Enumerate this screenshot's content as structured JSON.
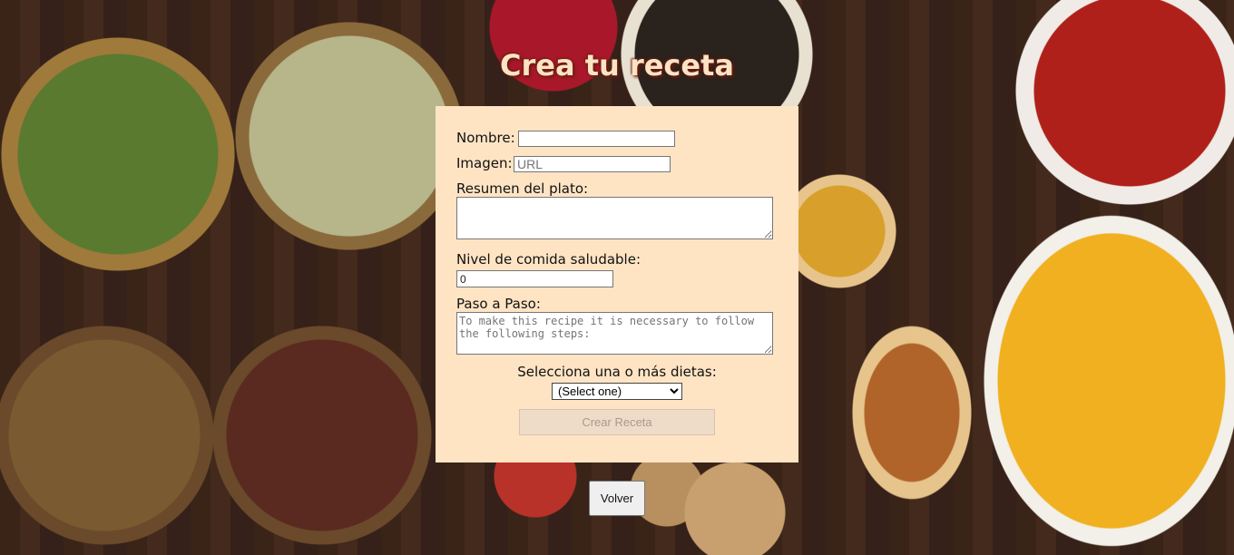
{
  "page": {
    "title": "Crea tu receta"
  },
  "form": {
    "nombre_label": "Nombre:",
    "nombre_value": "",
    "imagen_label": "Imagen:",
    "imagen_placeholder": "URL",
    "resumen_label": "Resumen del plato:",
    "resumen_value": "",
    "nivel_label": "Nivel de comida saludable:",
    "nivel_value": "0",
    "paso_label": "Paso a Paso:",
    "paso_placeholder": "To make this recipe it is necessary to follow the following steps:",
    "dietas_label": "Selecciona una o más dietas:",
    "dietas_selected": "(Select one)",
    "submit_label": "Crear Receta"
  },
  "nav": {
    "back_label": "Volver"
  },
  "colors": {
    "panel_bg": "#ffe4c4",
    "title_color": "#fbe4c4"
  }
}
